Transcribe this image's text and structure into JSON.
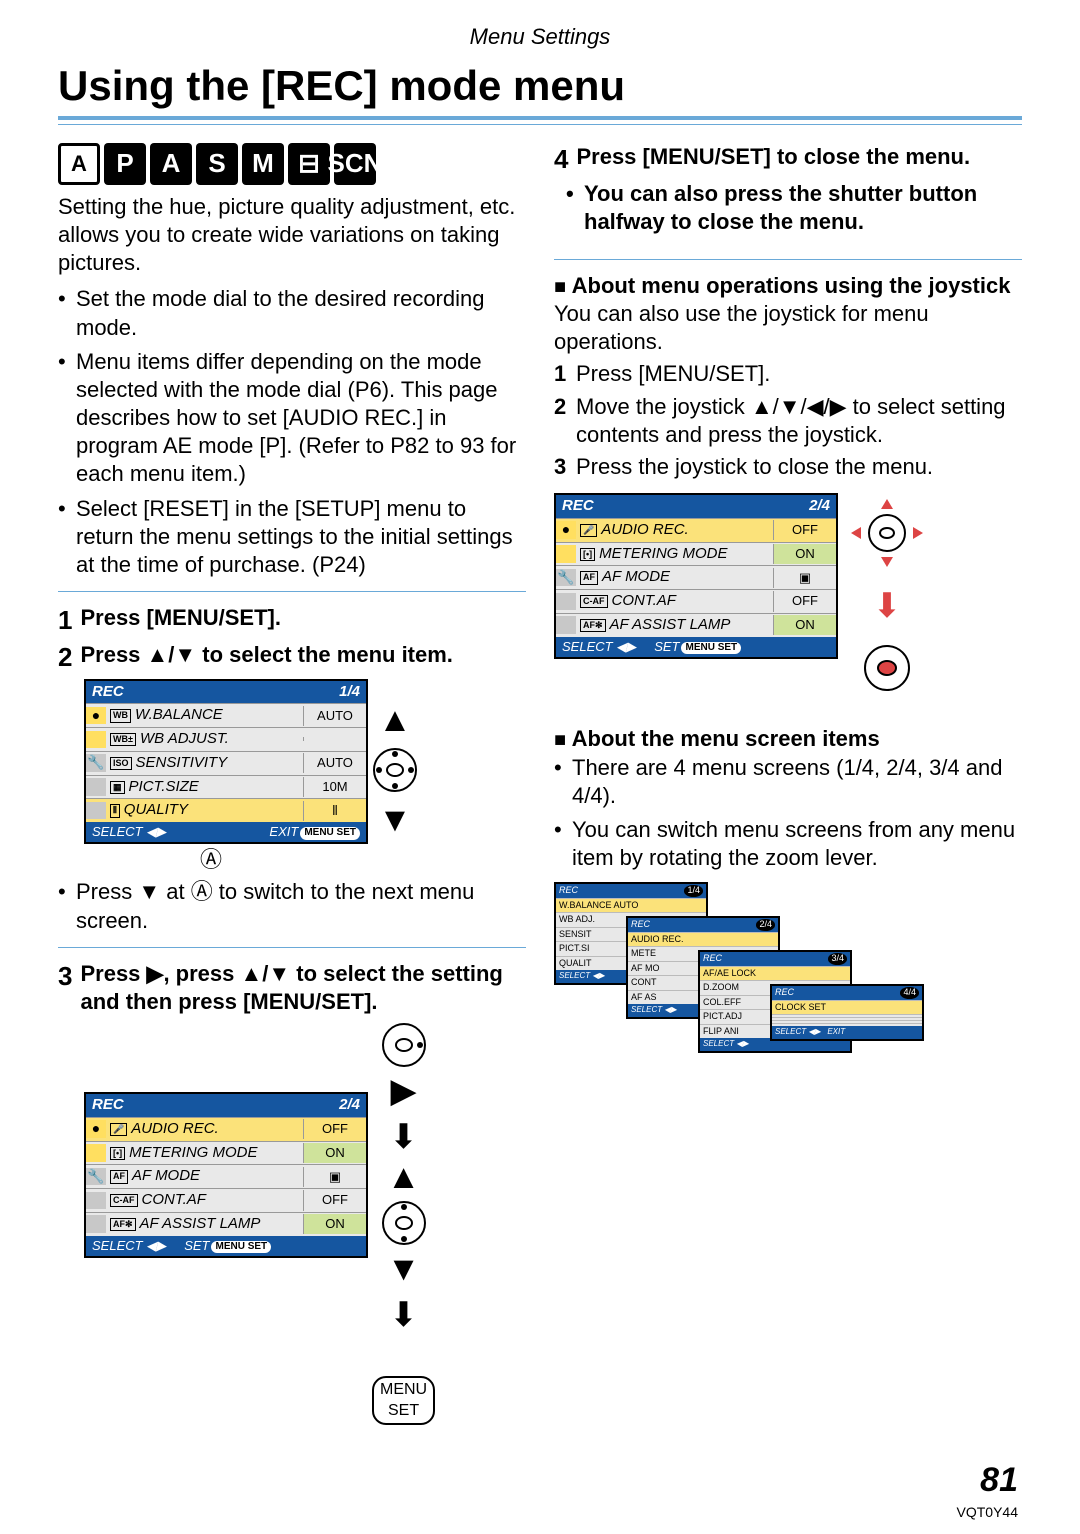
{
  "header": {
    "section": "Menu Settings",
    "title": "Using the [REC] mode menu"
  },
  "modes": [
    "A",
    "P",
    "A",
    "S",
    "M",
    "⊟",
    "SCN"
  ],
  "intro": "Setting the hue, picture quality adjustment, etc. allows you to create wide variations on taking pictures.",
  "bullets_left": [
    "Set the mode dial to the desired recording mode.",
    "Menu items differ depending on the mode selected with the mode dial (P6). This page describes how to set [AUDIO REC.] in program AE mode [P]. (Refer to P82 to 93 for each menu item.)",
    "Select [RESET] in the [SETUP] menu to return the menu settings to the initial settings at the time of purchase. (P24)"
  ],
  "steps": {
    "s1": "Press [MENU/SET].",
    "s2": "Press ▲/▼ to select the menu item.",
    "s2_note": "Press ▼ at Ⓐ to switch to the next menu screen.",
    "s3": "Press ▶, press ▲/▼ to select the setting and then press [MENU/SET].",
    "s4": "Press [MENU/SET] to close the menu.",
    "s4_b": "You can also press the shutter button halfway to close the menu."
  },
  "joyhdr": "About menu operations using the joystick",
  "joytext": "You can also use the joystick for menu operations.",
  "joylist": [
    "Press [MENU/SET].",
    "Move the joystick ▲/▼/◀/▶ to select setting contents and press the joystick.",
    "Press the joystick to close the menu."
  ],
  "scrhdr": "About the menu screen items",
  "scrbul": [
    "There are 4 menu screens (1/4, 2/4, 3/4 and 4/4).",
    "You can switch menu screens from any menu item by rotating the zoom lever."
  ],
  "menuset_lbl": "MENU\nSET",
  "lcd1": {
    "title": "REC",
    "page": "1/4",
    "rows": [
      {
        "icon": "WB",
        "label": "W.BALANCE",
        "val": "AUTO",
        "side": "●"
      },
      {
        "icon": "WB±",
        "label": "WB ADJUST.",
        "val": "",
        "side": ""
      },
      {
        "icon": "ISO",
        "label": "SENSITIVITY",
        "val": "AUTO",
        "side": "🔧"
      },
      {
        "icon": "▦",
        "label": "PICT.SIZE",
        "val": "10M",
        "side": ""
      },
      {
        "icon": "⫴",
        "label": "QUALITY",
        "val": "⫴",
        "side": "",
        "sel": true
      }
    ],
    "ftr_l": "SELECT ◀▶",
    "ftr_r": "EXIT",
    "ftr_pill": "MENU SET"
  },
  "lcd2": {
    "title": "REC",
    "page": "2/4",
    "rows": [
      {
        "icon": "🎤",
        "label": "AUDIO REC.",
        "val": "OFF",
        "side": "●",
        "sel": true
      },
      {
        "icon": "[•]",
        "label": "METERING MODE",
        "val": "ON",
        "side": "",
        "on": true
      },
      {
        "icon": "AF",
        "label": "AF MODE",
        "val": "▣",
        "side": "🔧"
      },
      {
        "icon": "C-AF",
        "label": "CONT.AF",
        "val": "OFF",
        "side": ""
      },
      {
        "icon": "AF✻",
        "label": "AF ASSIST LAMP",
        "val": "ON",
        "side": "",
        "on": true
      }
    ],
    "ftr_l": "SELECT ◀▶",
    "ftr_m": "SET",
    "ftr_pill": "MENU SET"
  },
  "minis": [
    {
      "title": "REC",
      "pg": "1/4",
      "rows": [
        "W.BALANCE   AUTO",
        "WB ADJ.",
        "SENSIT",
        "PICT.SI",
        "QUALIT"
      ],
      "sel": 0
    },
    {
      "title": "REC",
      "pg": "2/4",
      "rows": [
        "AUDIO REC.",
        "METE",
        "AF MO",
        "CONT",
        "AF AS"
      ],
      "sel": 0
    },
    {
      "title": "REC",
      "pg": "3/4",
      "rows": [
        "AF/AE LOCK",
        "D.ZOOM",
        "COL.EFF",
        "PICT.ADJ",
        "FLIP ANI"
      ],
      "sel": 0
    },
    {
      "title": "REC",
      "pg": "4/4",
      "rows": [
        "CLOCK SET",
        "",
        "",
        "",
        ""
      ],
      "sel": 0
    }
  ],
  "page_number": "81",
  "doc_id": "VQT0Y44",
  "mark": "Ⓐ"
}
